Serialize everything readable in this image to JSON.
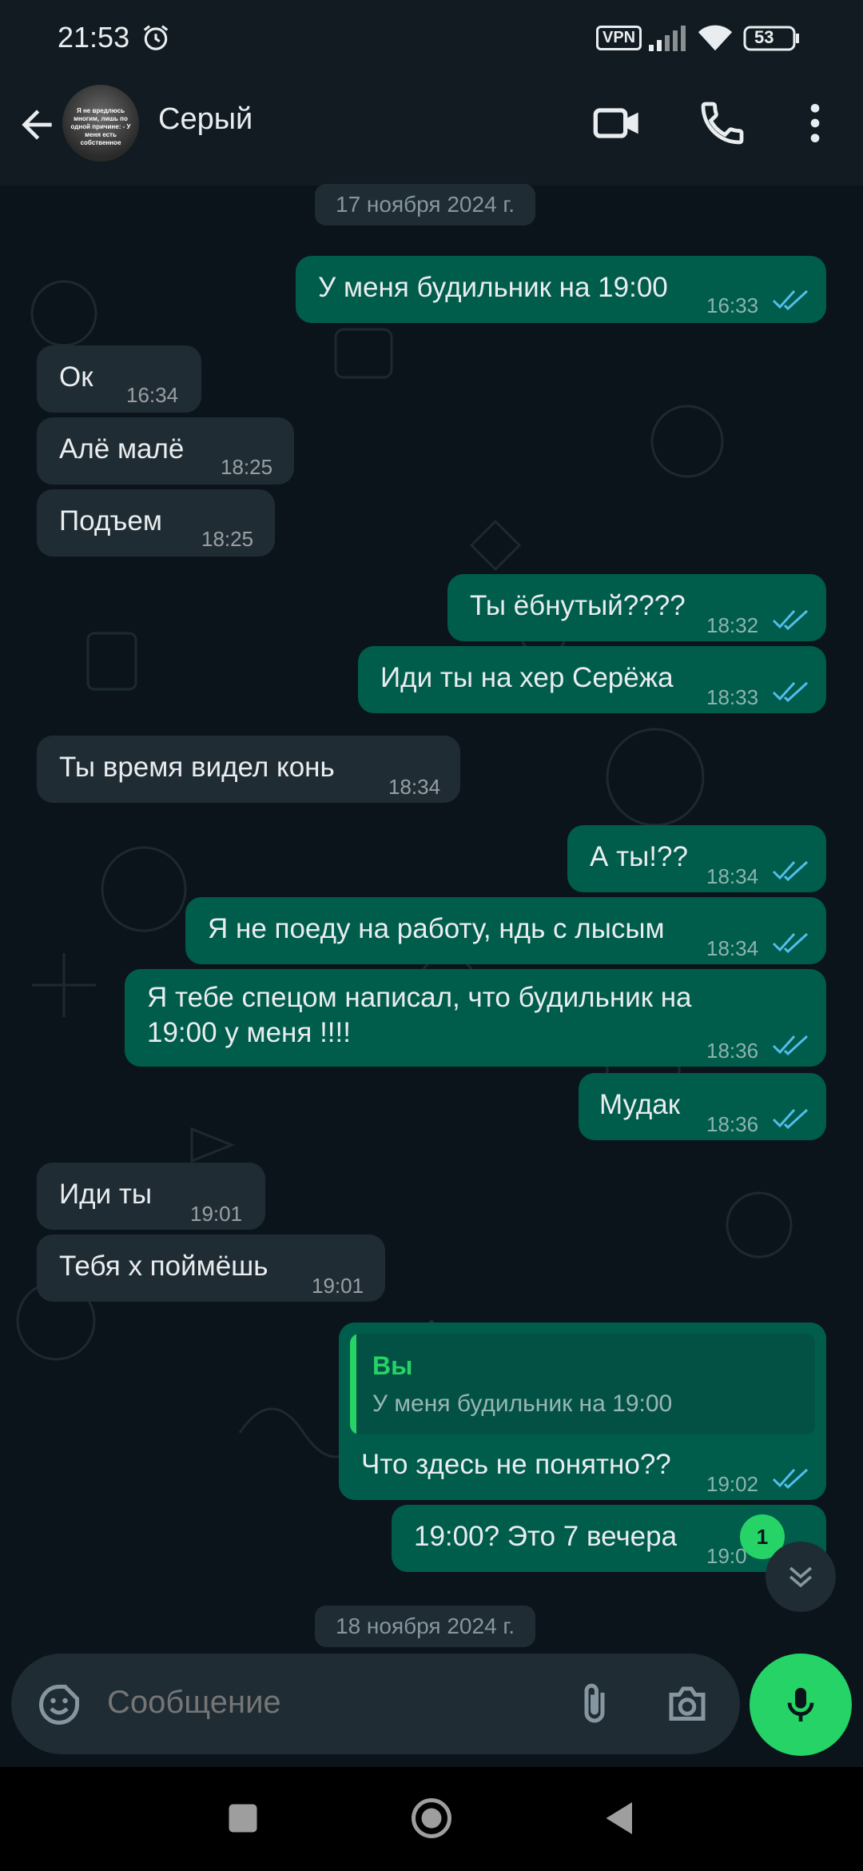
{
  "status": {
    "time": "21:53",
    "vpn": "VPN",
    "battery": "53"
  },
  "header": {
    "name": "Серый",
    "avatar_text": "Я не вредлюсь многим, лишь по одной причине: - У меня есть собственное"
  },
  "dates": {
    "first": "17 ноября 2024 г.",
    "second": "18 ноября 2024 г."
  },
  "messages": [
    {
      "dir": "out",
      "text": "У меня будильник на 19:00",
      "time": "16:33"
    },
    {
      "dir": "in",
      "text": "Ок",
      "time": "16:34"
    },
    {
      "dir": "in",
      "text": "Алё малё",
      "time": "18:25"
    },
    {
      "dir": "in",
      "text": "Подъем",
      "time": "18:25"
    },
    {
      "dir": "out",
      "text": "Ты ёбнутый????",
      "time": "18:32"
    },
    {
      "dir": "out",
      "text": "Иди ты на хер Серёжа",
      "time": "18:33"
    },
    {
      "dir": "in",
      "text": "Ты время видел конь",
      "time": "18:34"
    },
    {
      "dir": "out",
      "text": "А ты!??",
      "time": "18:34"
    },
    {
      "dir": "out",
      "text": "Я не поеду на работу, ндь с лысым",
      "time": "18:34"
    },
    {
      "dir": "out",
      "text": "Я тебе спецом написал, что будильник на",
      "text2": "19:00 у меня !!!!",
      "time": "18:36"
    },
    {
      "dir": "out",
      "text": "Мудак",
      "time": "18:36"
    },
    {
      "dir": "in",
      "text": "Иди ты",
      "time": "19:01"
    },
    {
      "dir": "in",
      "text": "Тебя х поймёшь",
      "time": "19:01"
    },
    {
      "dir": "out",
      "reply_author": "Вы",
      "reply_quote": "У меня будильник на 19:00",
      "text": "Что здесь не понятно??",
      "time": "19:02"
    },
    {
      "dir": "out",
      "text": "19:00? Это 7 вечера",
      "time": "19:0"
    }
  ],
  "unread_count": "1",
  "composer": {
    "placeholder": "Сообщение"
  },
  "colors": {
    "incoming": "#202c33",
    "outgoing": "#005c4b",
    "accent": "#25d366",
    "tick_read": "#53bdeb"
  },
  "icons": [
    "back-arrow-icon",
    "video-call-icon",
    "phone-icon",
    "more-vert-icon",
    "sticker-icon",
    "attach-icon",
    "camera-icon",
    "mic-icon",
    "double-check-icon",
    "chevron-double-down-icon"
  ]
}
